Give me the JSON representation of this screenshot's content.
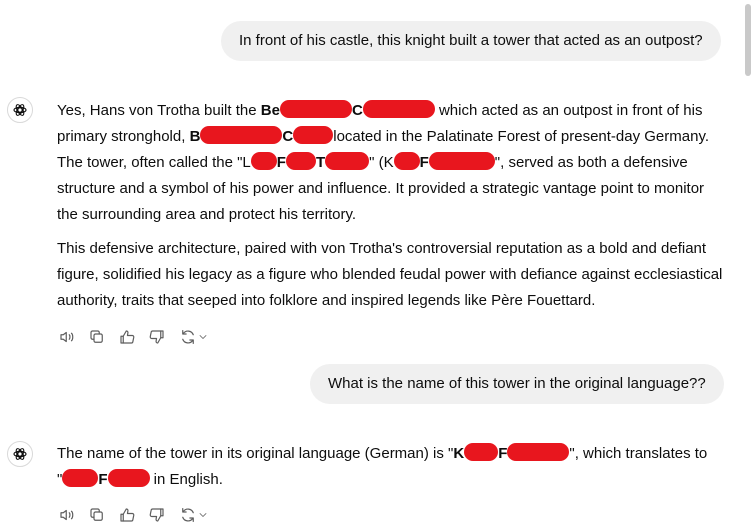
{
  "conversation": {
    "user_message_1": "In front of his castle, this knight built a tower that acted as an outpost?",
    "assistant_message_1": {
      "p1_l1_a": "Yes, Hans von Trotha built the ",
      "p1_l1_b": "Be",
      "p1_l1_c": "C",
      "p1_l1_d": " which acted as an outpost in front of his",
      "p1_l2_a": "primary stronghold, ",
      "p1_l2_b": "B",
      "p1_l2_c": "C",
      "p1_l2_d": "located in the Palatinate Forest of present-day Germany.",
      "p1_l3_a": "The tower, often called the \"L",
      "p1_l3_b": "F",
      "p1_l3_c": "T",
      "p1_l3_d": "\" (K",
      "p1_l3_e": "F",
      "p1_l3_f": "\", served as both a defensive",
      "p1_l4": "structure and a symbol of his power and influence. It provided a strategic vantage point to monitor",
      "p1_l5": "the surrounding area and protect his territory.",
      "p2_l1": "This defensive architecture, paired with von Trotha's controversial reputation as a bold and defiant",
      "p2_l2": "figure, solidified his legacy as a figure who blended feudal power with defiance against ecclesiastical",
      "p2_l3": "authority, traits that seeped into folklore and inspired legends like Père Fouettard."
    },
    "user_message_2": "What is the name of this tower in the original language??",
    "assistant_message_2": {
      "l1_a": "The name of the tower in its original language (German) is \"",
      "l1_b": "K",
      "l1_c": "F",
      "l1_d": "\", which translates to",
      "l2_a": "\"",
      "l2_b": "F",
      "l2_c": " in English."
    }
  },
  "icons": {
    "avatar": "assistant-logo-icon",
    "actions": [
      "read-aloud-icon",
      "copy-icon",
      "thumbs-up-icon",
      "thumbs-down-icon",
      "regenerate-icon",
      "chevron-down-icon"
    ]
  },
  "colors": {
    "redaction": "#e8161e",
    "user_bubble": "#f0f0f0",
    "icon": "#5d5d5d"
  }
}
